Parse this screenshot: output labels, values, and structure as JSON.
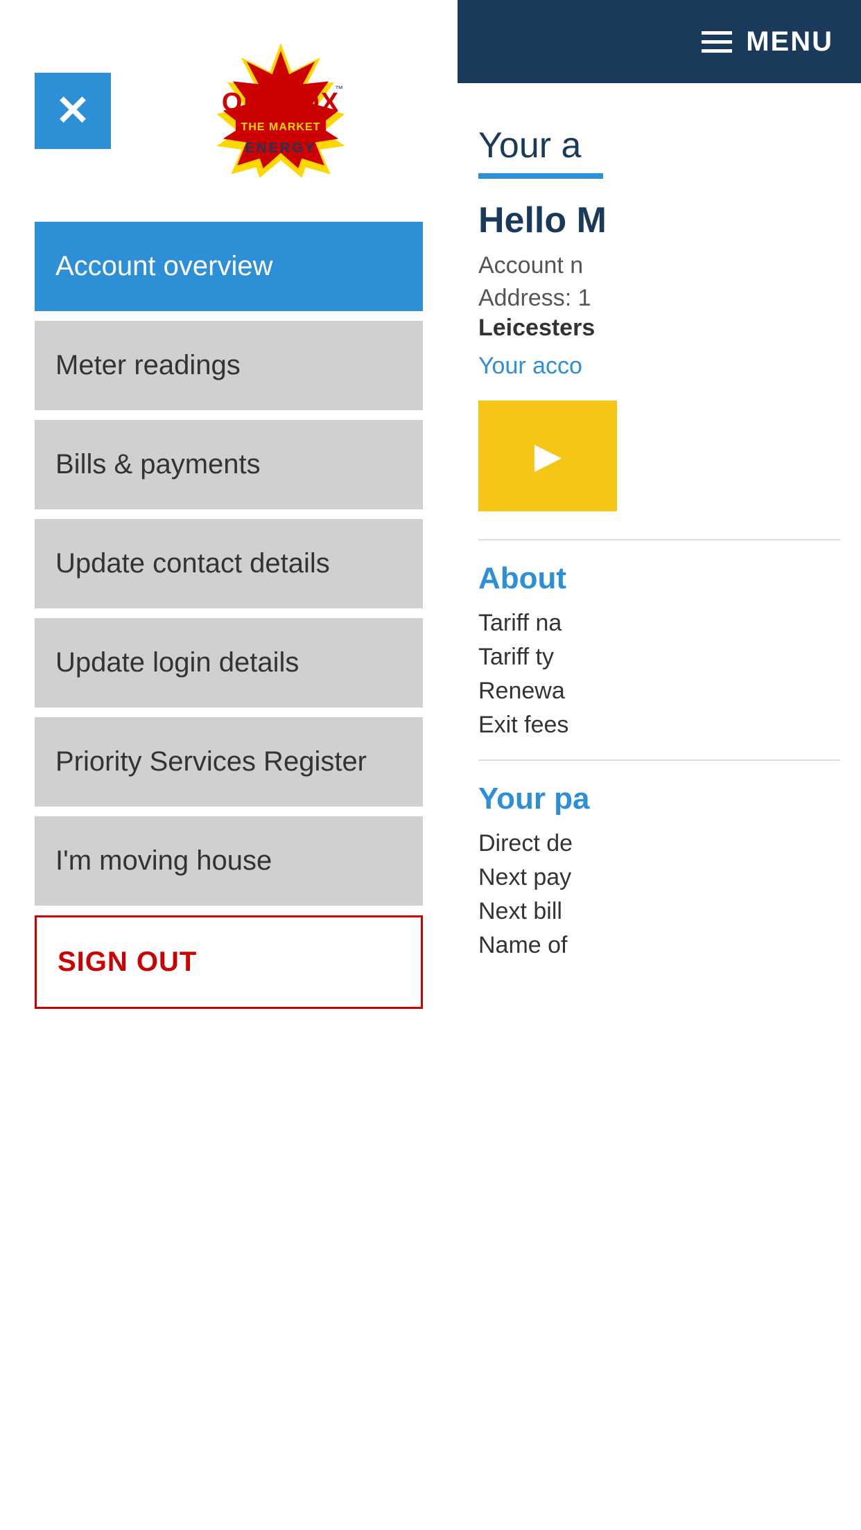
{
  "brand": {
    "name": "OUTFOX THE MARKET ENERGY",
    "logo_text_outfox": "OUTFOX",
    "logo_text_market": "THE MARKET",
    "logo_text_energy": "ENERGY"
  },
  "header": {
    "menu_label": "MENU"
  },
  "close_button": {
    "label": "×"
  },
  "nav": {
    "items": [
      {
        "id": "account-overview",
        "label": "Account overview",
        "active": true
      },
      {
        "id": "meter-readings",
        "label": "Meter readings",
        "active": false
      },
      {
        "id": "bills-payments",
        "label": "Bills & payments",
        "active": false
      },
      {
        "id": "update-contact",
        "label": "Update contact details",
        "active": false
      },
      {
        "id": "update-login",
        "label": "Update login details",
        "active": false
      },
      {
        "id": "priority-services",
        "label": "Priority Services Register",
        "active": false
      },
      {
        "id": "moving-house",
        "label": "I'm moving house",
        "active": false
      }
    ],
    "sign_out_label": "SIGN OUT"
  },
  "main": {
    "page_title": "Your a",
    "hello_text": "Hello M",
    "account_number_label": "Account n",
    "address_label": "Address: 1",
    "address_city": "Leicesters",
    "account_link": "Your acco",
    "about_title": "About",
    "tariff_name_label": "Tariff na",
    "tariff_type_label": "Tariff ty",
    "renewal_label": "Renewa",
    "exit_fees_label": "Exit fees",
    "your_pa_title": "Your pa",
    "direct_debit_label": "Direct de",
    "next_payment_label": "Next pay",
    "next_bill_label": "Next bill",
    "name_of_label": "Name of"
  },
  "colors": {
    "blue_accent": "#2d8fd5",
    "dark_navy": "#1a3a5c",
    "light_gray": "#d0d0d0",
    "red": "#cc0000",
    "yellow": "#f5c518",
    "white": "#ffffff"
  }
}
